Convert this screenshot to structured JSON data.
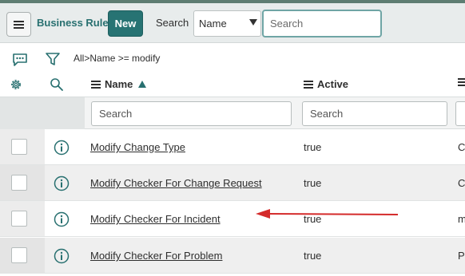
{
  "header": {
    "title": "Business Rules",
    "new_label": "New",
    "search_label": "Search",
    "search_field_selected": "Name",
    "search_placeholder": "Search"
  },
  "breadcrumb": {
    "all": "All",
    "separator": ">",
    "condition": "Name >= modify"
  },
  "columns": [
    {
      "label": "Name",
      "sorted": "ascending"
    },
    {
      "label": "Active"
    }
  ],
  "filters": {
    "name_placeholder": "Search",
    "active_placeholder": "Search"
  },
  "rows": [
    {
      "name": "Modify Change Type",
      "active": "true",
      "third": "C"
    },
    {
      "name": "Modify Checker For Change Request",
      "active": "true",
      "third": "C"
    },
    {
      "name": "Modify Checker For Incident",
      "active": "true",
      "third": "m"
    },
    {
      "name": "Modify Checker For Problem",
      "active": "true",
      "third": "P"
    }
  ],
  "colors": {
    "accent": "#287070",
    "new_button": "#277373",
    "annotation_arrow": "#d42b2b"
  },
  "icons": [
    "menu-icon",
    "chat-icon",
    "funnel-icon",
    "gear-icon",
    "magnify-icon",
    "info-icon",
    "sort-ascending-icon"
  ]
}
